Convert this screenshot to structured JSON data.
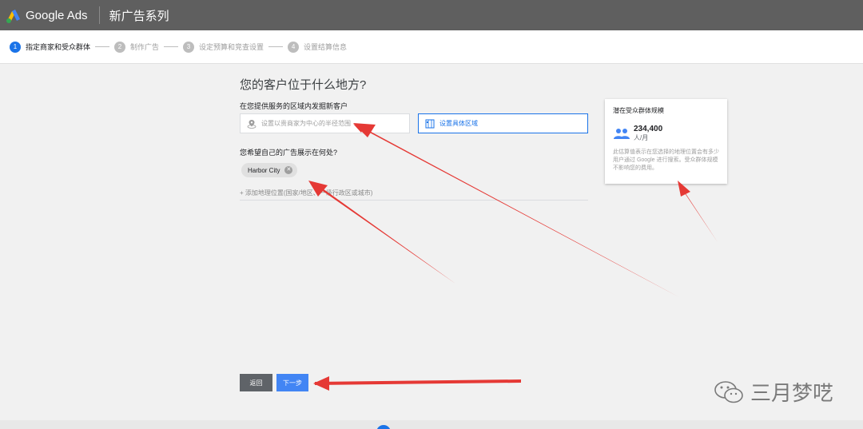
{
  "header": {
    "brand": "Google Ads",
    "campaign_title": "新广告系列"
  },
  "stepper": [
    {
      "num": "1",
      "label": "指定商家和受众群体",
      "active": true
    },
    {
      "num": "2",
      "label": "制作广告",
      "active": false
    },
    {
      "num": "3",
      "label": "设定预算和竞查设置",
      "active": false
    },
    {
      "num": "4",
      "label": "设置结算信息",
      "active": false
    }
  ],
  "main": {
    "question": "您的客户位于什么地方?",
    "serve_label": "在您提供服务的区域内发掘新客户",
    "radius_placeholder": "设置以贵商家为中心的半径范围",
    "area_label": "设置具体区域",
    "show_label": "您希望自己的广告展示在何处?",
    "chip_location": "Harbor City",
    "add_location": "+ 添加地理位置(国家/地区、一级行政区或城市)"
  },
  "reach": {
    "title": "潜在受众群体规模",
    "number": "234,400",
    "unit": "人/月",
    "description": "此估算值表示在您选择的地理位置会有多少用户通过 Google 进行搜索。受众群体规模不影响您的费用。"
  },
  "buttons": {
    "back": "返回",
    "next": "下一步"
  },
  "watermark": {
    "text": "三月梦呓",
    "icon": "wechat-icon"
  },
  "colors": {
    "topbar": "#5f5f5f",
    "accent": "#1a73e8",
    "next_button": "#4285f4",
    "arrow": "#e53935"
  }
}
